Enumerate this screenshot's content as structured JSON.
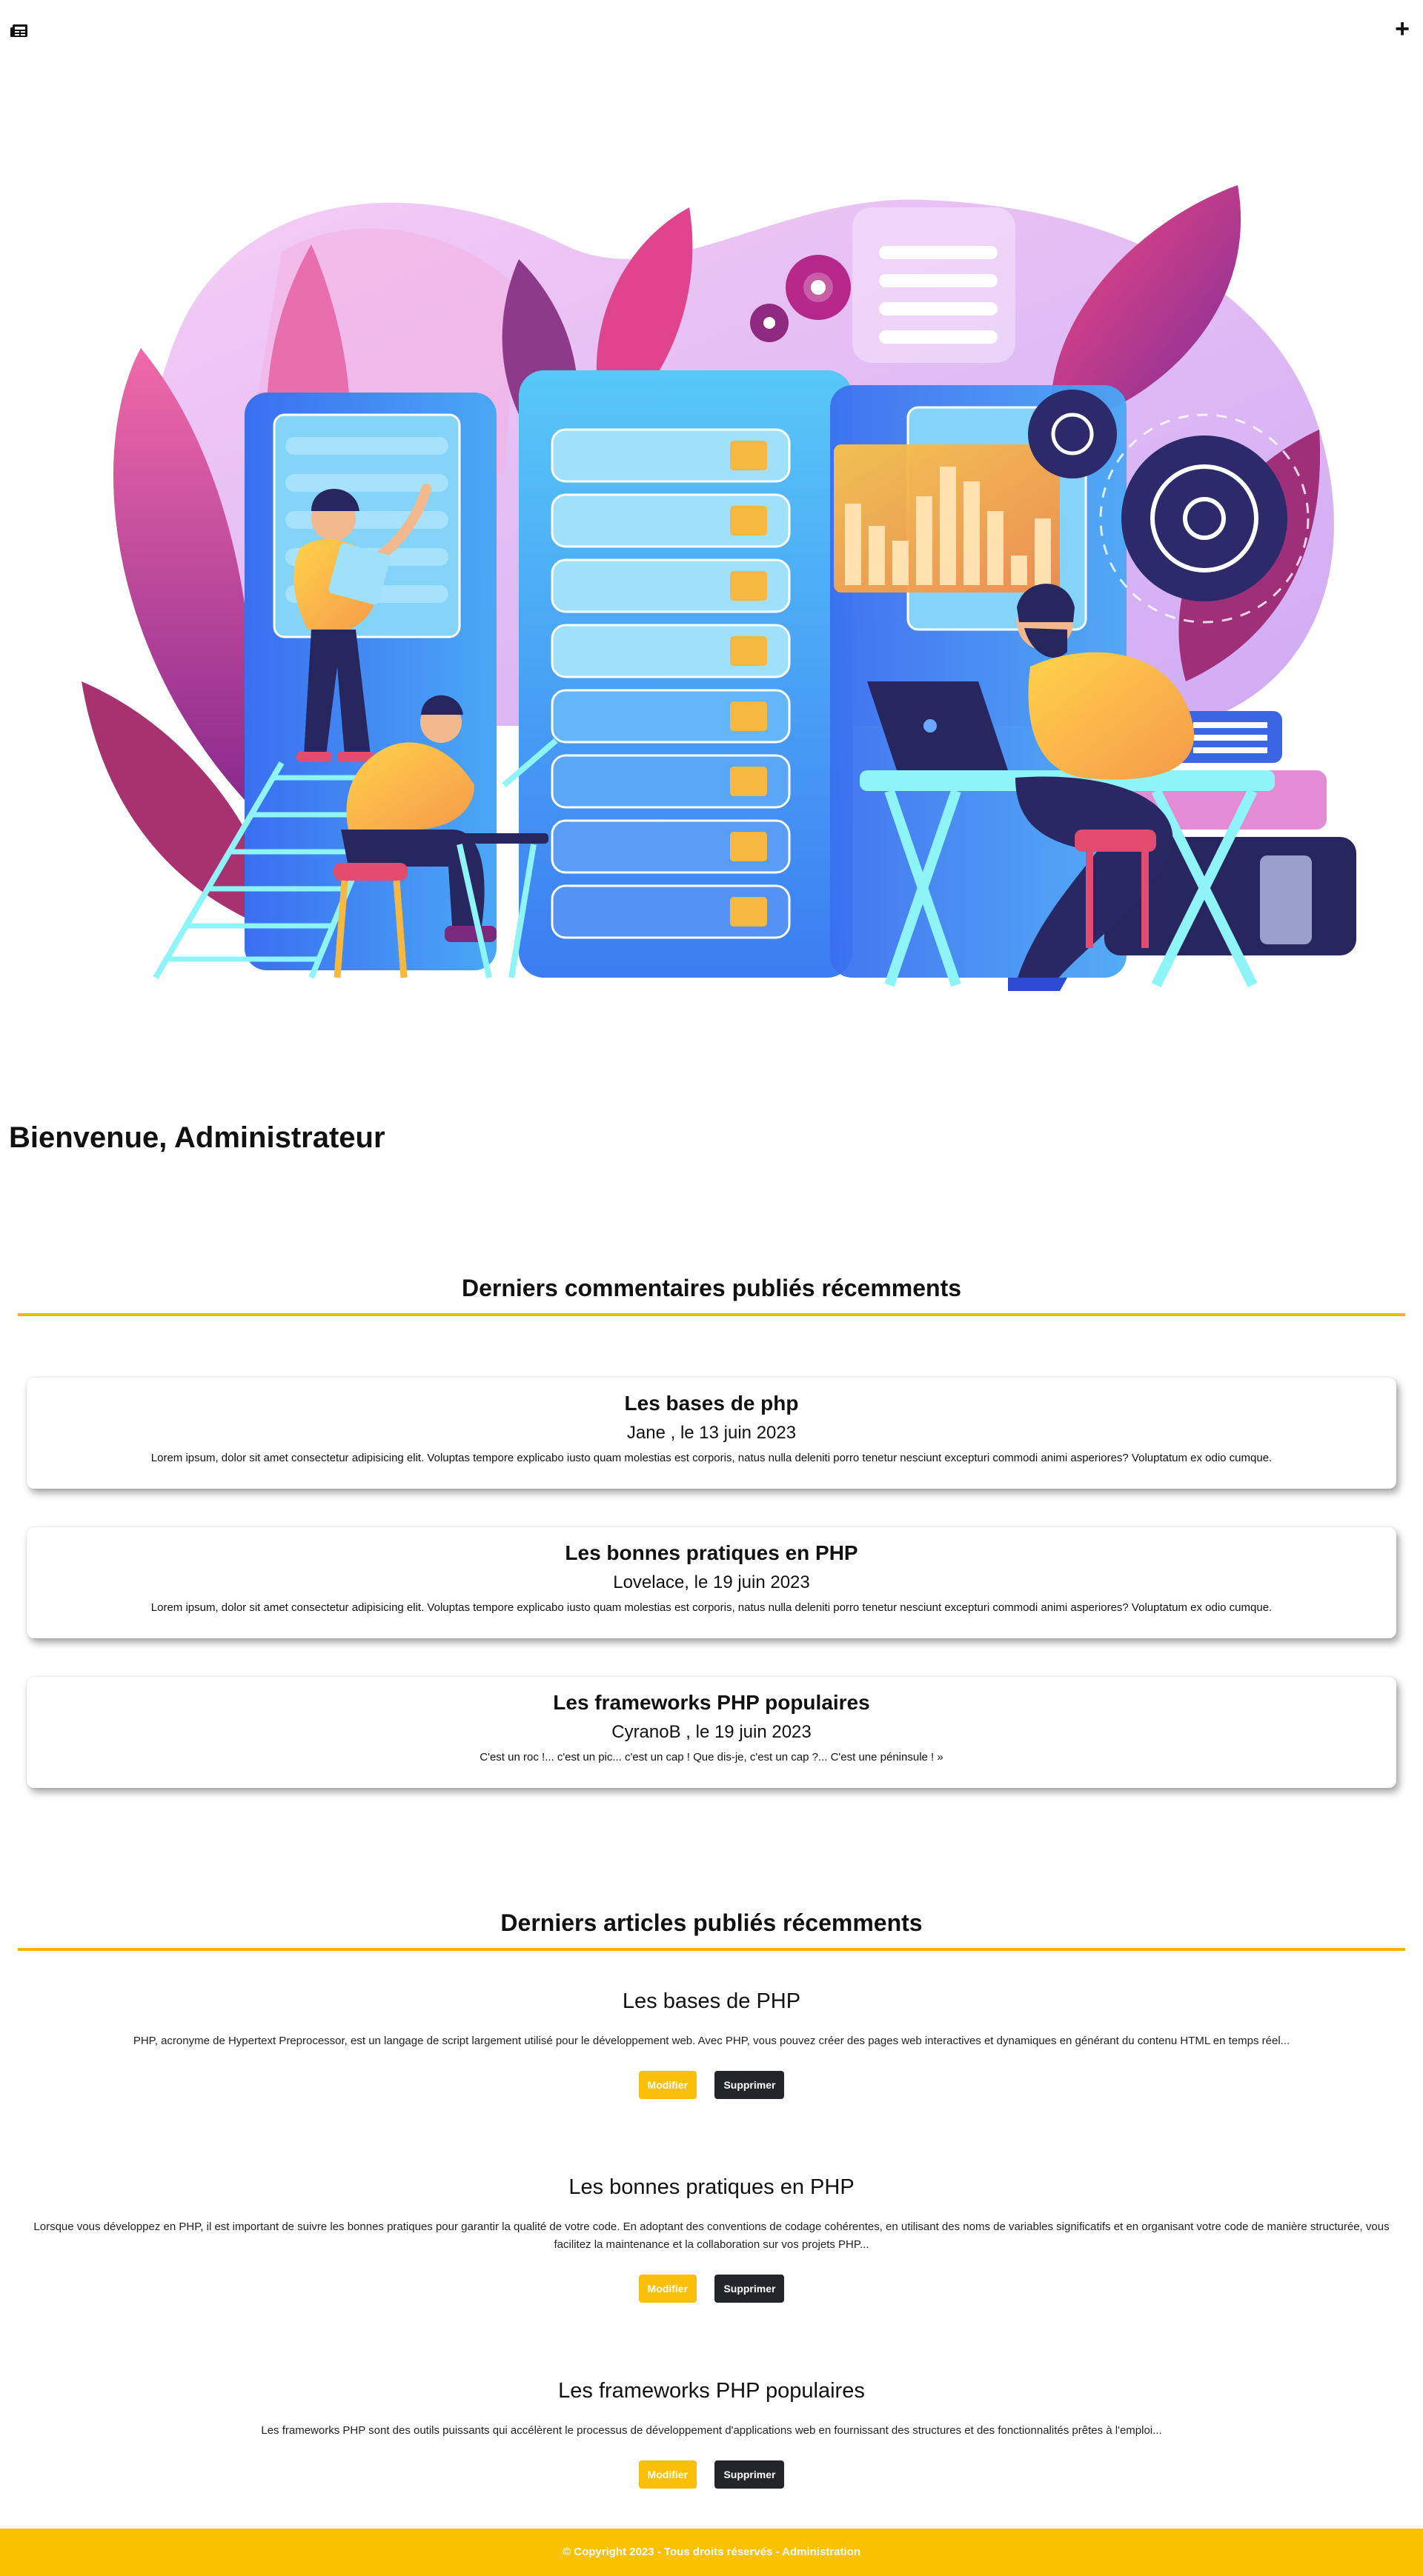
{
  "topbar": {
    "logo_icon": "newspaper-icon",
    "add_icon": "plus-icon",
    "add_label": "+"
  },
  "hero": {
    "illustration": "data-center-illustration",
    "colors": {
      "pink": "#e8489a",
      "purple": "#c89af0",
      "blue": "#3a8cf6",
      "cyan": "#5fd0f5",
      "navy": "#28265e",
      "yellow": "#f9c54a"
    }
  },
  "welcome": "Bienvenue, Administrateur",
  "comments_section": {
    "title": "Derniers commentaires publiés récemments",
    "items": [
      {
        "title": "Les bases de php",
        "meta": "Jane , le 13 juin 2023",
        "text": "Lorem ipsum, dolor sit amet consectetur adipisicing elit. Voluptas tempore explicabo iusto quam molestias est corporis, natus nulla deleniti porro tenetur nesciunt excepturi commodi animi asperiores? Voluptatum ex odio cumque."
      },
      {
        "title": "Les bonnes pratiques en PHP",
        "meta": "Lovelace, le 19 juin 2023",
        "text": "Lorem ipsum, dolor sit amet consectetur adipisicing elit. Voluptas tempore explicabo iusto quam molestias est corporis, natus nulla deleniti porro tenetur nesciunt excepturi commodi animi asperiores? Voluptatum ex odio cumque."
      },
      {
        "title": "Les frameworks PHP populaires",
        "meta": "CyranoB , le 19 juin 2023",
        "text": "C'est un roc !... c'est un pic... c'est un cap ! Que dis-je, c'est un cap ?... C'est une péninsule ! »"
      }
    ]
  },
  "articles_section": {
    "title": "Derniers articles publiés récemments",
    "edit_label": "Modifier",
    "delete_label": "Supprimer",
    "items": [
      {
        "title": "Les bases de PHP",
        "text": "PHP, acronyme de Hypertext Preprocessor, est un langage de script largement utilisé pour le développement web. Avec PHP, vous pouvez créer des pages web interactives et dynamiques en générant du contenu HTML en temps réel..."
      },
      {
        "title": "Les bonnes pratiques en PHP",
        "text": "Lorsque vous développez en PHP, il est important de suivre les bonnes pratiques pour garantir la qualité de votre code. En adoptant des conventions de codage cohérentes, en utilisant des noms de variables significatifs et en organisant votre code de manière structurée, vous facilitez la maintenance et la collaboration sur vos projets PHP..."
      },
      {
        "title": "Les frameworks PHP populaires",
        "text": "Les frameworks PHP sont des outils puissants qui accélèrent le processus de développement d'applications web en fournissant des structures et des fonctionnalités prêtes à l'emploi..."
      }
    ]
  },
  "footer": {
    "text": "© Copyright 2023 - Tous droits réservés - Administration"
  }
}
